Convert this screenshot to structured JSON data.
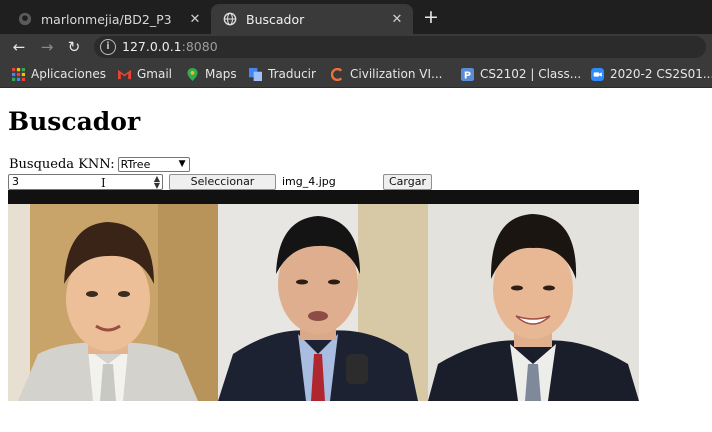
{
  "browser": {
    "tabs": [
      {
        "title": "marlonmejia/BD2_P3",
        "active": false
      },
      {
        "title": "Buscador",
        "active": true
      }
    ],
    "new_tab_symbol": "+",
    "close_symbol": "✕",
    "url_host": "127.0.0.1",
    "url_port": ":8080",
    "bookmarks": [
      {
        "label": "Aplicaciones",
        "icon": "apps-grid-icon"
      },
      {
        "label": "Gmail",
        "icon": "gmail-icon"
      },
      {
        "label": "Maps",
        "icon": "maps-icon"
      },
      {
        "label": "Traducir",
        "icon": "translate-icon"
      },
      {
        "label": "Civilization VI...",
        "icon": "civilization-icon"
      },
      {
        "label": "CS2102 | Class...",
        "icon": "pronto-icon"
      },
      {
        "label": "2020-2 CS2S01...",
        "icon": "zoom-icon"
      }
    ]
  },
  "page": {
    "heading": "Buscador",
    "knn_label": "Busqueda KNN:",
    "knn_selected": "RTree",
    "k_value": "3",
    "file_button": "Seleccionar archivo",
    "file_name": "img_4.jpg",
    "load_button": "Cargar",
    "results": [
      {
        "alt": "result-face-1"
      },
      {
        "alt": "result-face-2"
      },
      {
        "alt": "result-face-3"
      }
    ]
  },
  "colors": {
    "tabbar": "#1f1f1f",
    "toolbar": "#3a3a3a",
    "results_bg": "#111111"
  }
}
